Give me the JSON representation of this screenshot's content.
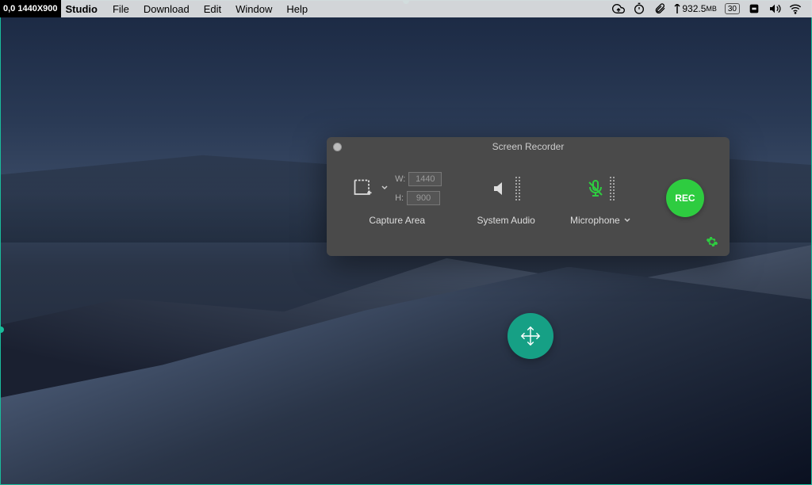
{
  "selection": {
    "readout": "0,0 1440X900"
  },
  "menubar": {
    "app_name": "Studio",
    "items": [
      "File",
      "Download",
      "Edit",
      "Window",
      "Help"
    ],
    "status": {
      "memory": "932.5",
      "memory_unit": "MB",
      "fps": "30"
    }
  },
  "recorder": {
    "title": "Screen Recorder",
    "capture": {
      "label": "Capture Area",
      "w_label": "W:",
      "w_value": "1440",
      "h_label": "H:",
      "h_value": "900"
    },
    "system_audio": {
      "label": "System Audio"
    },
    "microphone": {
      "label": "Microphone"
    },
    "rec_label": "REC"
  },
  "icons": {
    "crop": "crop-add-icon",
    "chevron_down": "chevron-down-icon",
    "speaker": "speaker-icon",
    "microphone": "microphone-icon",
    "gear": "gear-icon",
    "move": "move-arrows-icon",
    "cloud": "cloud-upload-icon",
    "stopwatch": "stopwatch-icon",
    "paperclip": "paperclip-icon",
    "menu_square": "menu-square-icon",
    "volume": "volume-icon",
    "wifi": "wifi-icon"
  },
  "colors": {
    "accent": "#1abc9c",
    "rec": "#2ecc40",
    "panel": "#4a4a4a"
  }
}
